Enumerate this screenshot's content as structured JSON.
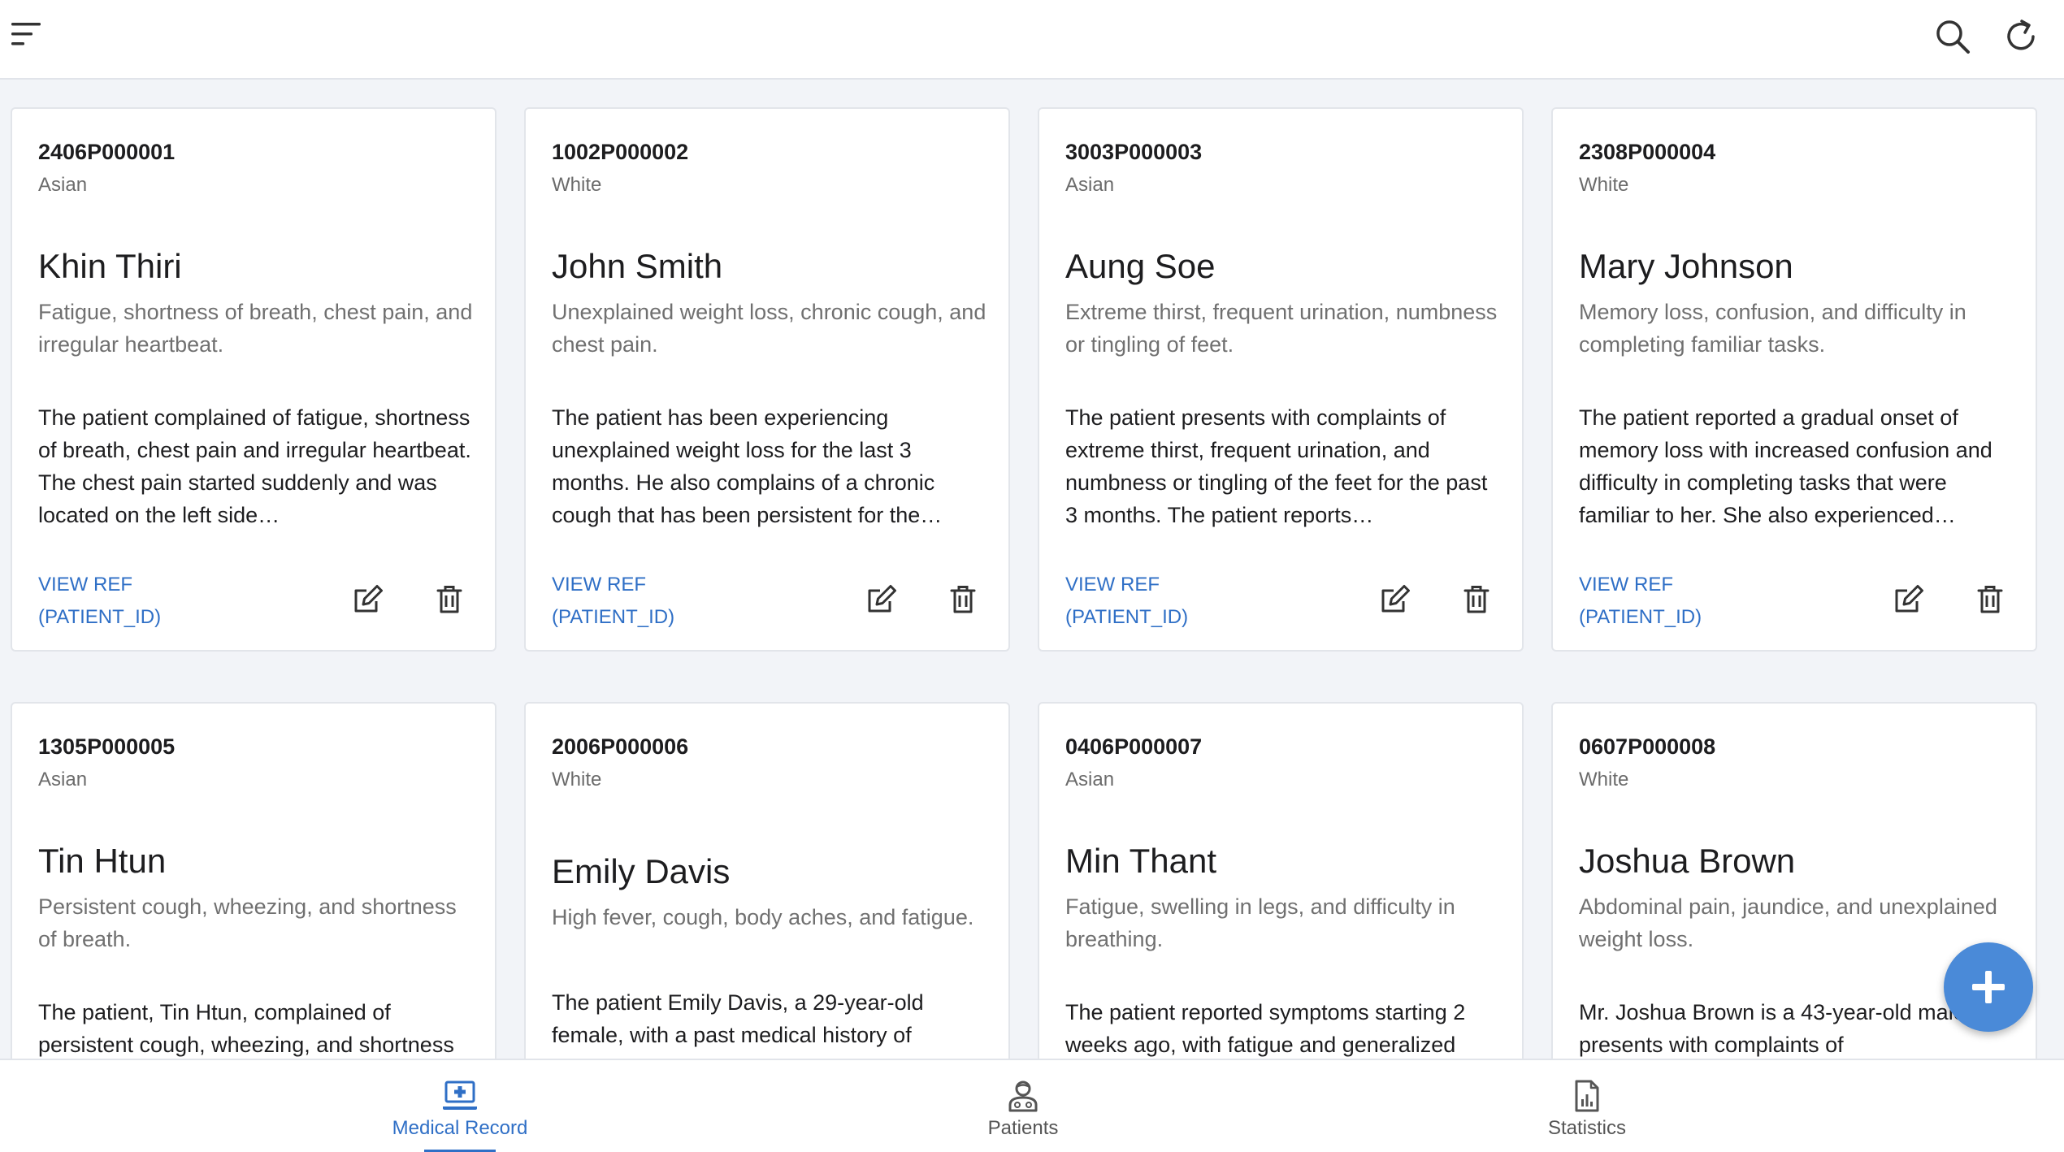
{
  "header": {
    "menu_icon": "menu-icon",
    "search_icon": "search-icon",
    "refresh_icon": "refresh-icon"
  },
  "records": [
    {
      "patient_id": "2406P000001",
      "race": "Asian",
      "name": "Khin Thiri",
      "summary": "Fatigue, shortness of breath, chest pain, and irregular heartbeat.",
      "description": "The patient complained of fatigue, shortness of breath, chest pain and irregular heartbeat. The chest pain started suddenly and was located on the left side…",
      "view_ref": "VIEW REF",
      "view_ref_sub": "(PATIENT_ID)"
    },
    {
      "patient_id": "1002P000002",
      "race": "White",
      "name": "John Smith",
      "summary": "Unexplained weight loss, chronic cough, and chest pain.",
      "description": "The patient has been experiencing unexplained weight loss for the last 3 months. He also complains of a chronic cough that has been persistent for the…",
      "view_ref": "VIEW REF",
      "view_ref_sub": "(PATIENT_ID)"
    },
    {
      "patient_id": "3003P000003",
      "race": "Asian",
      "name": "Aung Soe",
      "summary": "Extreme thirst, frequent urination, numbness or tingling of feet.",
      "description": "The patient presents with complaints of extreme thirst, frequent urination, and numbness or tingling of the feet for the past 3 months. The patient reports…",
      "view_ref": "VIEW REF",
      "view_ref_sub": "(PATIENT_ID)"
    },
    {
      "patient_id": "2308P000004",
      "race": "White",
      "name": "Mary Johnson",
      "summary": "Memory loss, confusion, and difficulty in completing familiar tasks.",
      "description": "The patient reported a gradual onset of memory loss with increased confusion and difficulty in completing tasks that were familiar to her. She also experienced…",
      "view_ref": "VIEW REF",
      "view_ref_sub": "(PATIENT_ID)"
    },
    {
      "patient_id": "1305P000005",
      "race": "Asian",
      "name": "Tin Htun",
      "summary": "Persistent cough, wheezing, and shortness of breath.",
      "description": "The patient, Tin Htun, complained of persistent cough, wheezing, and shortness",
      "view_ref": "VIEW REF",
      "view_ref_sub": "(PATIENT_ID)"
    },
    {
      "patient_id": "2006P000006",
      "race": "White",
      "name": "Emily Davis",
      "summary": "High fever, cough, body aches, and fatigue.",
      "description": "The patient Emily Davis, a 29-year-old female, with a past medical history of",
      "view_ref": "VIEW REF",
      "view_ref_sub": "(PATIENT_ID)"
    },
    {
      "patient_id": "0406P000007",
      "race": "Asian",
      "name": "Min Thant",
      "summary": "Fatigue, swelling in legs, and difficulty in breathing.",
      "description": "The patient reported symptoms starting 2 weeks ago, with fatigue and generalized",
      "view_ref": "VIEW REF",
      "view_ref_sub": "(PATIENT_ID)"
    },
    {
      "patient_id": "0607P000008",
      "race": "White",
      "name": "Joshua Brown",
      "summary": "Abdominal pain, jaundice, and unexplained weight loss.",
      "description": "Mr. Joshua Brown is a 43-year-old male who presents with complaints of",
      "view_ref": "VIEW REF",
      "view_ref_sub": "(PATIENT_ID)"
    }
  ],
  "card_icons": {
    "edit": "edit-icon",
    "delete": "trash-icon"
  },
  "fab": {
    "icon": "plus-icon"
  },
  "bottom_nav": {
    "items": [
      {
        "label": "Medical Record",
        "icon": "medical-record-icon",
        "active": true
      },
      {
        "label": "Patients",
        "icon": "patients-icon",
        "active": false
      },
      {
        "label": "Statistics",
        "icon": "statistics-icon",
        "active": false
      }
    ]
  },
  "colors": {
    "accent": "#2f6fc6",
    "fab": "#4a8ad8",
    "background": "#f2f4f8"
  }
}
